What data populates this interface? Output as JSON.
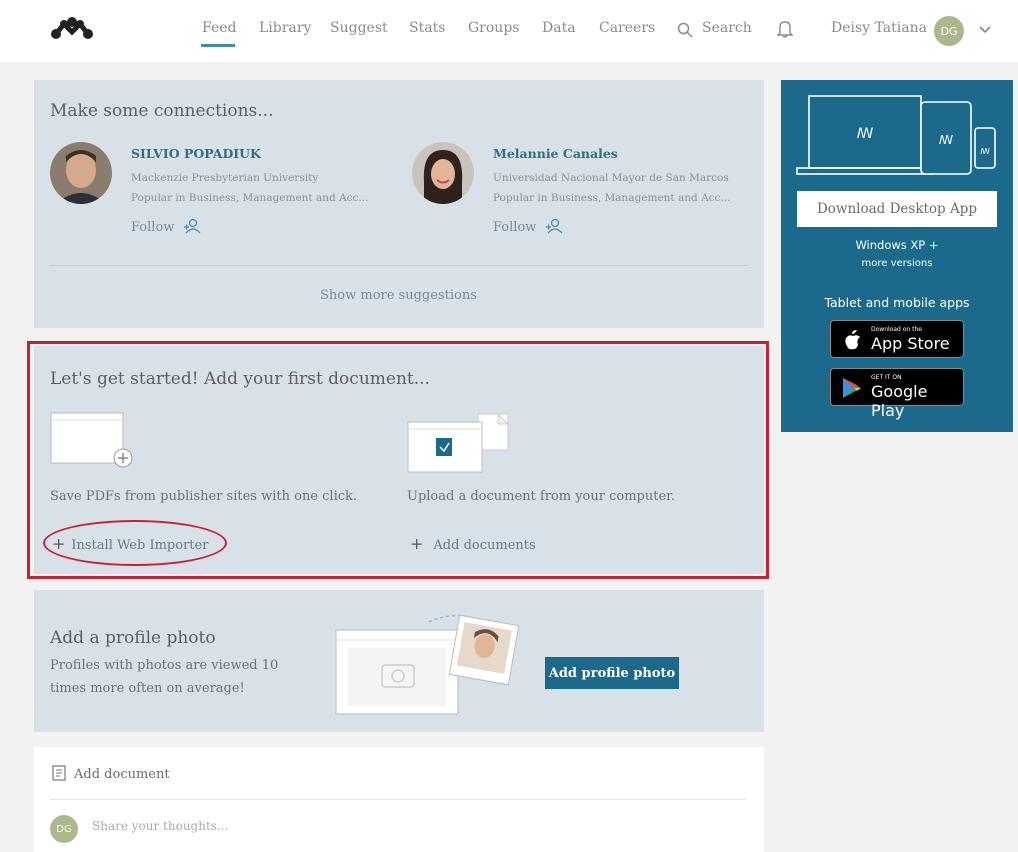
{
  "nav": {
    "items": [
      "Feed",
      "Library",
      "Suggest",
      "Stats",
      "Groups",
      "Data",
      "Careers"
    ],
    "search_label": "Search",
    "user_name": "Deisy Tatiana",
    "user_initials": "DG"
  },
  "connections": {
    "title": "Make some connections...",
    "people": [
      {
        "name": "SILVIO POPADIUK",
        "institution": "Mackenzie Presbyterian University",
        "popular": "Popular in Business, Management and Acc...",
        "follow": "Follow"
      },
      {
        "name": "Melannie Canales",
        "institution": "Universidad Nacional Mayor de San Marcos",
        "popular": "Popular in Business, Management and Acc...",
        "follow": "Follow"
      }
    ],
    "show_more": "Show more suggestions"
  },
  "get_started": {
    "title": "Let's get started! Add your first document...",
    "web_importer_desc": "Save PDFs from publisher sites with one click.",
    "web_importer_action": "Install Web Importer",
    "upload_desc": "Upload a document from your computer.",
    "upload_action": "Add documents"
  },
  "profile_photo": {
    "title": "Add a profile photo",
    "desc_line1": "Profiles with photos are viewed 10",
    "desc_line2": "times more often on average!",
    "button": "Add profile photo"
  },
  "composer": {
    "add_document": "Add document",
    "placeholder": "Share your thoughts..."
  },
  "sidebar": {
    "download_button": "Download Desktop App",
    "windows": "Windows XP +",
    "more_versions": "more versions",
    "mobile_title": "Tablet and mobile apps",
    "app_store_small": "Download on the",
    "app_store": "App Store",
    "google_play_small": "GET IT ON",
    "google_play": "Google Play"
  },
  "colors": {
    "accent": "#1b6a8c",
    "card_bg": "#d9e1e8",
    "highlight": "#c8212f"
  }
}
